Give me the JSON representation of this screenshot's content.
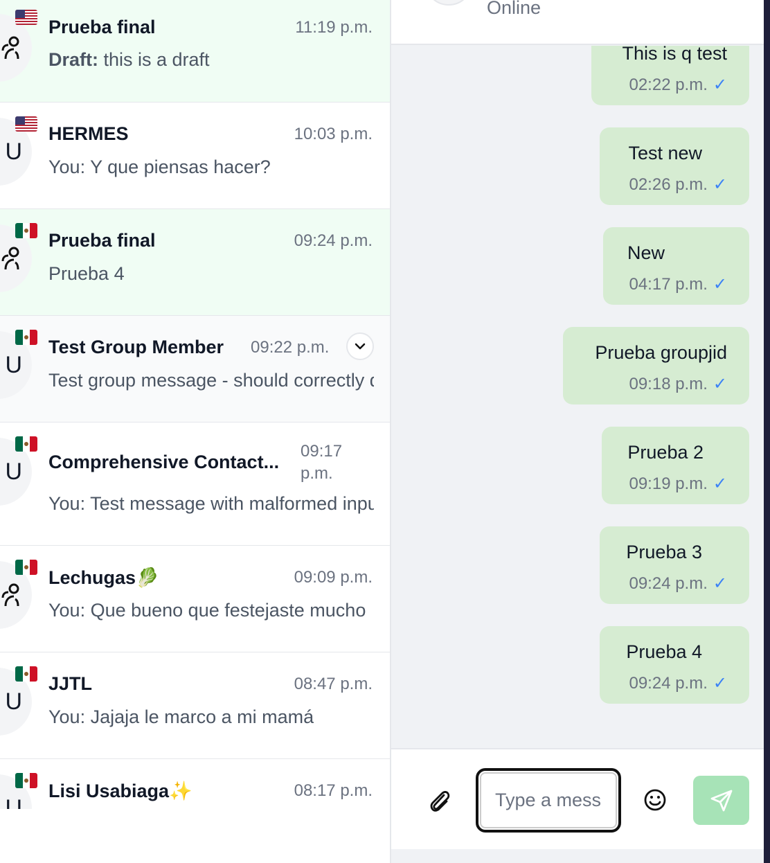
{
  "conversations": [
    {
      "name": "Prueba final",
      "time": "11:19 p.m.",
      "draft_label": "Draft:",
      "preview": " this is a draft",
      "flag": "us",
      "avatar": "group-icon"
    },
    {
      "name": "HERMES",
      "time": "10:03 p.m.",
      "preview": "You: Y que piensas hacer?",
      "flag": "us",
      "avatar": "U"
    },
    {
      "name": "Prueba final",
      "time": "09:24 p.m.",
      "preview": "Prueba 4",
      "flag": "mx",
      "avatar": "group-icon"
    },
    {
      "name": "Test Group Member",
      "time": "09:22 p.m.",
      "preview": "Test group message - should correctly display",
      "flag": "mx",
      "avatar": "U"
    },
    {
      "name": "Comprehensive Contact...",
      "time_line1": "09:17",
      "time_line2": "p.m.",
      "preview": "You: Test message with malformed input",
      "flag": "mx",
      "avatar": "U"
    },
    {
      "name": "Lechugas🥬",
      "time": "09:09 p.m.",
      "preview": "You: Que bueno que festejaste mucho",
      "flag": "mx",
      "avatar": "group-icon"
    },
    {
      "name": "JJTL",
      "time": "08:47 p.m.",
      "preview": "You: Jajaja le marco a mi mamá",
      "flag": "mx",
      "avatar": "U"
    },
    {
      "name": "Lisi Usabiaga✨",
      "time": "08:17 p.m.",
      "flag": "mx",
      "avatar": "U"
    }
  ],
  "chat": {
    "status": "Online",
    "messages": [
      {
        "text": "This is q test",
        "time": "02:22 p.m.",
        "tick": "✓"
      },
      {
        "text": "Test new",
        "time": "02:26 p.m.",
        "tick": "✓"
      },
      {
        "text": "New",
        "time": "04:17 p.m.",
        "tick": "✓"
      },
      {
        "text": "Prueba groupjid",
        "time": "09:18 p.m.",
        "tick": "✓"
      },
      {
        "text": "Prueba 2",
        "time": "09:19 p.m.",
        "tick": "✓"
      },
      {
        "text": "Prueba 3",
        "time": "09:24 p.m.",
        "tick": "✓"
      },
      {
        "text": "Prueba 4",
        "time": "09:24 p.m.",
        "tick": "✓"
      }
    ],
    "composer": {
      "placeholder": "Type a message",
      "attach_icon": "paperclip-icon",
      "emoji_icon": "smiley-icon",
      "send_icon": "send-icon"
    }
  },
  "colors": {
    "accent_green": "#a7e3b7",
    "bubble": "#d6ecd2",
    "selected_row": "#f0fdf4",
    "tick": "#3b82f6"
  }
}
